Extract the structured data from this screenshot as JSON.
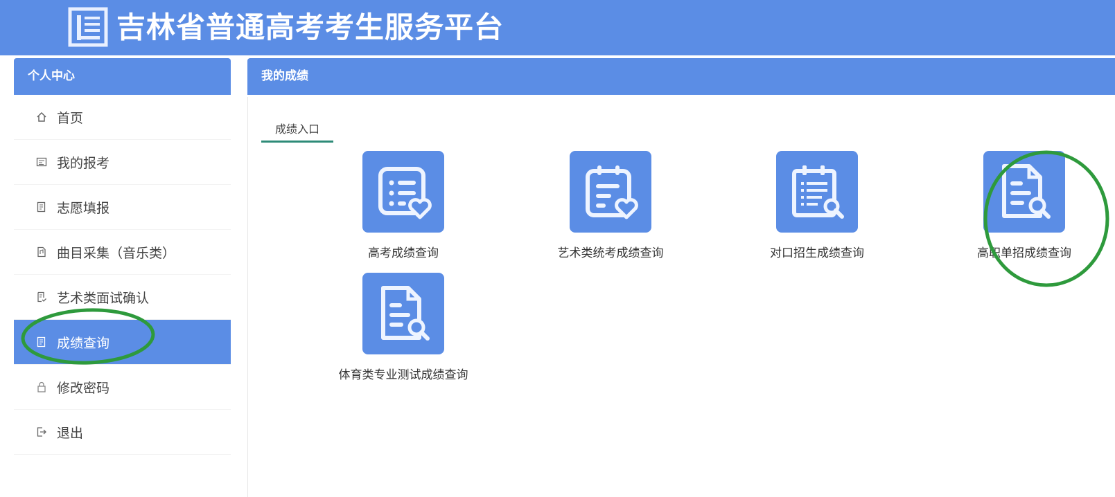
{
  "header": {
    "title": "吉林省普通高考考生服务平台",
    "logo_icon": "document-logo-icon"
  },
  "sidebar": {
    "title": "个人中心",
    "items": [
      {
        "label": "首页",
        "icon": "home-icon",
        "active": false
      },
      {
        "label": "我的报考",
        "icon": "register-icon",
        "active": false
      },
      {
        "label": "志愿填报",
        "icon": "form-icon",
        "active": false
      },
      {
        "label": "曲目采集（音乐类）",
        "icon": "music-file-icon",
        "active": false
      },
      {
        "label": "艺术类面试确认",
        "icon": "confirm-doc-icon",
        "active": false
      },
      {
        "label": "成绩查询",
        "icon": "score-doc-icon",
        "active": true
      },
      {
        "label": "修改密码",
        "icon": "lock-icon",
        "active": false
      },
      {
        "label": "退出",
        "icon": "logout-icon",
        "active": false
      }
    ]
  },
  "main": {
    "title": "我的成绩",
    "tab": "成绩入口",
    "cards": [
      {
        "label": "高考成绩查询",
        "icon": "list-heart-icon"
      },
      {
        "label": "艺术类统考成绩查询",
        "icon": "clipboard-heart-icon"
      },
      {
        "label": "对口招生成绩查询",
        "icon": "clipboard-search-icon"
      },
      {
        "label": "高职单招成绩查询",
        "icon": "document-search-icon"
      },
      {
        "label": "体育类专业测试成绩查询",
        "icon": "document-search-icon"
      }
    ]
  },
  "colors": {
    "brand_blue": "#5b8de5",
    "tab_underline": "#2e8b78",
    "annotation_green": "#2e9a3c"
  }
}
